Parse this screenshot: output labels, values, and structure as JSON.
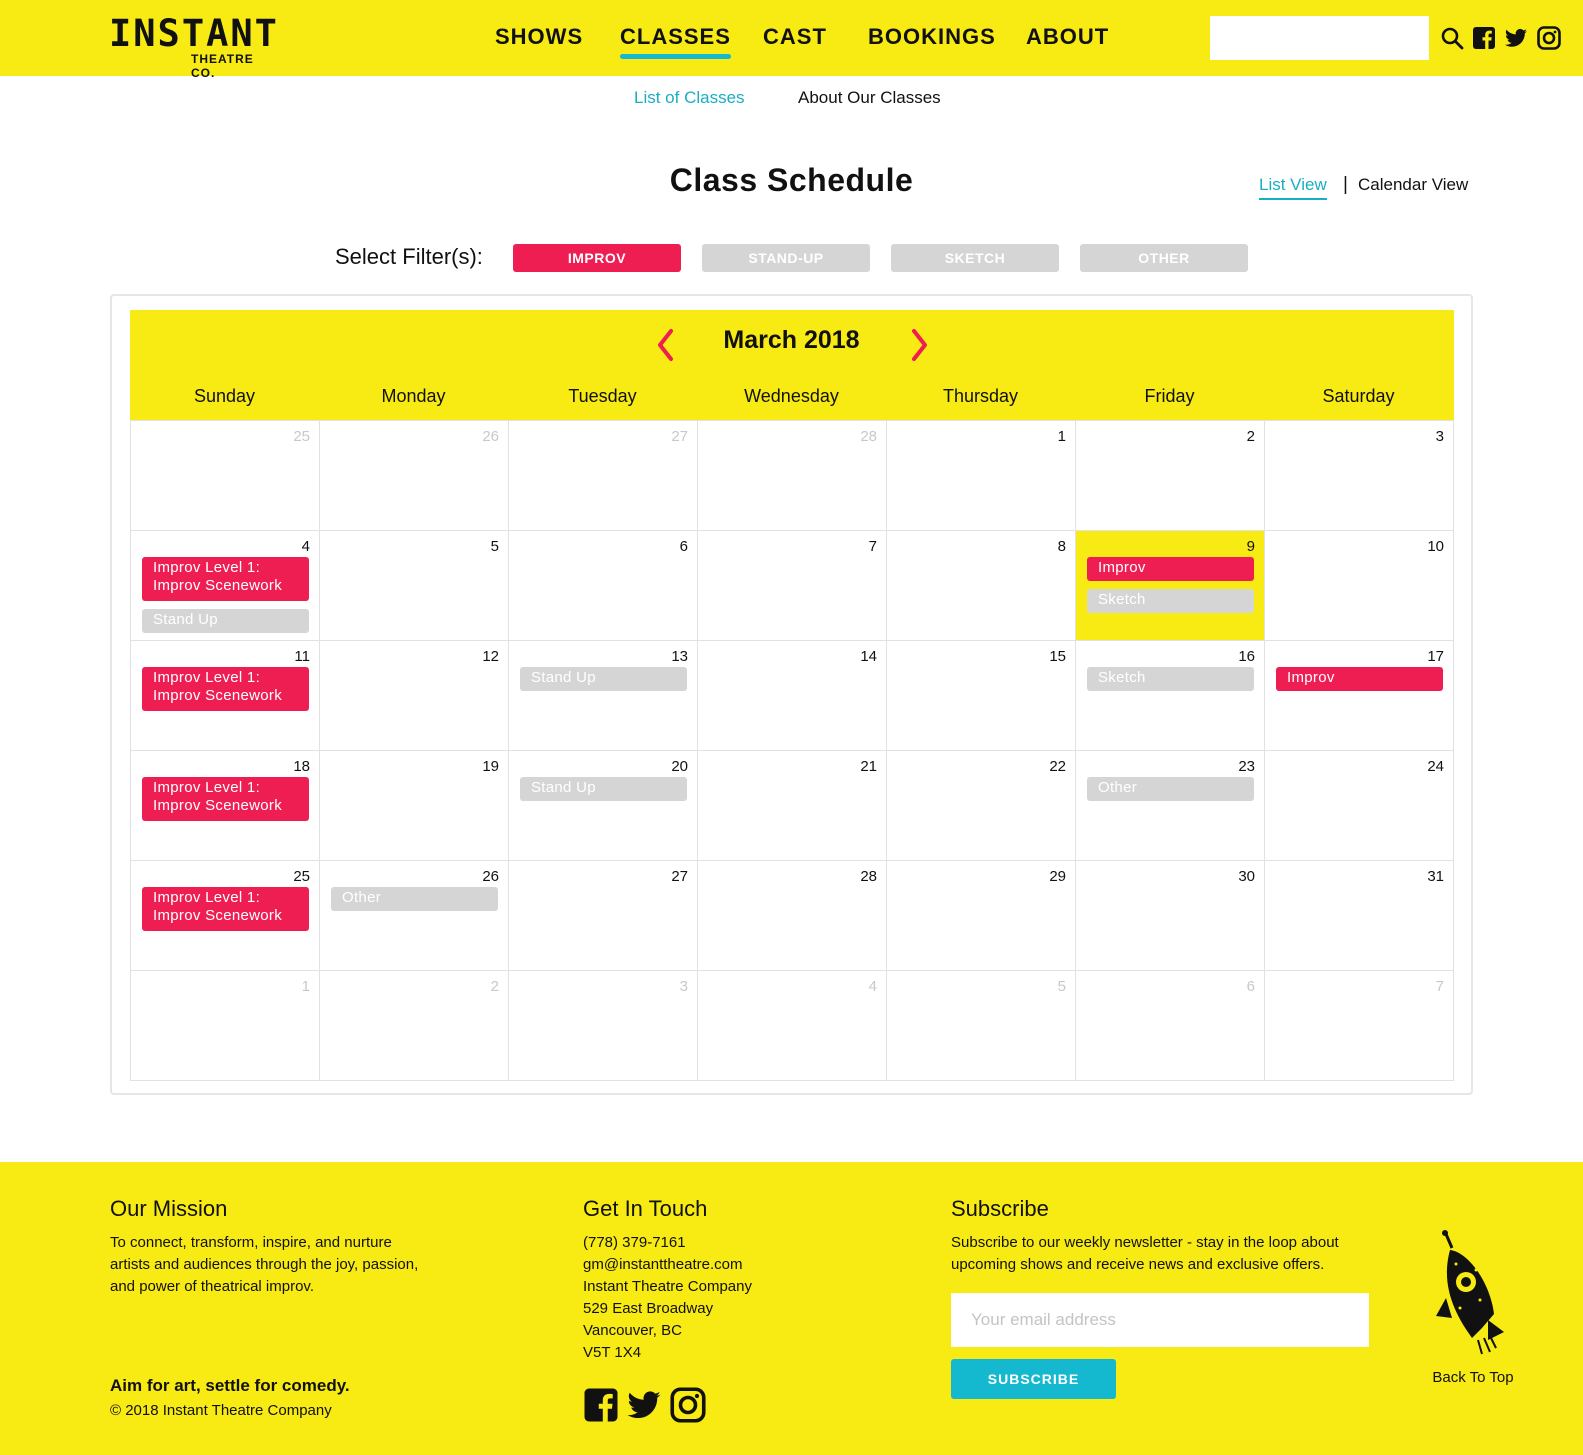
{
  "brand": {
    "logo_main": "INSTANT",
    "logo_sub": "THEATRE CO."
  },
  "nav": [
    {
      "label": "SHOWS",
      "active": false
    },
    {
      "label": "CLASSES",
      "active": true
    },
    {
      "label": "CAST",
      "active": false
    },
    {
      "label": "BOOKINGS",
      "active": false
    },
    {
      "label": "ABOUT",
      "active": false
    }
  ],
  "header_icons": [
    "search-icon",
    "facebook-icon",
    "twitter-icon",
    "instagram-icon"
  ],
  "subnav": [
    {
      "label": "List of Classes",
      "active": true
    },
    {
      "label": "About Our Classes",
      "active": false
    }
  ],
  "page_title": "Class Schedule",
  "views": {
    "list": "List View",
    "separator": "|",
    "calendar": "Calendar View",
    "active": "list"
  },
  "filters": {
    "label": "Select Filter(s):",
    "items": [
      {
        "label": "IMPROV",
        "on": true
      },
      {
        "label": "STAND-UP",
        "on": false
      },
      {
        "label": "SKETCH",
        "on": false
      },
      {
        "label": "OTHER",
        "on": false
      }
    ]
  },
  "calendar": {
    "month": "March 2018",
    "weekdays": [
      "Sunday",
      "Monday",
      "Tuesday",
      "Wednesday",
      "Thursday",
      "Friday",
      "Saturday"
    ],
    "weeks": [
      [
        {
          "day": "25",
          "dim": true,
          "events": []
        },
        {
          "day": "26",
          "dim": true,
          "events": []
        },
        {
          "day": "27",
          "dim": true,
          "events": []
        },
        {
          "day": "28",
          "dim": true,
          "events": []
        },
        {
          "day": "1",
          "events": []
        },
        {
          "day": "2",
          "events": []
        },
        {
          "day": "3",
          "events": []
        }
      ],
      [
        {
          "day": "4",
          "events": [
            {
              "label": "Improv Level 1: Improv Scenework",
              "type": "improv"
            },
            {
              "label": "Stand Up",
              "type": "standup"
            }
          ]
        },
        {
          "day": "5",
          "events": []
        },
        {
          "day": "6",
          "events": []
        },
        {
          "day": "7",
          "events": []
        },
        {
          "day": "8",
          "events": []
        },
        {
          "day": "9",
          "highlight": true,
          "events": [
            {
              "label": "Improv",
              "type": "improv"
            },
            {
              "label": "Sketch",
              "type": "sketch"
            }
          ]
        },
        {
          "day": "10",
          "events": []
        }
      ],
      [
        {
          "day": "11",
          "events": [
            {
              "label": "Improv Level 1: Improv Scenework",
              "type": "improv"
            }
          ]
        },
        {
          "day": "12",
          "events": []
        },
        {
          "day": "13",
          "events": [
            {
              "label": "Stand Up",
              "type": "standup"
            }
          ]
        },
        {
          "day": "14",
          "events": []
        },
        {
          "day": "15",
          "events": []
        },
        {
          "day": "16",
          "events": [
            {
              "label": "Sketch",
              "type": "sketch"
            }
          ]
        },
        {
          "day": "17",
          "events": [
            {
              "label": "Improv",
              "type": "improv"
            }
          ]
        }
      ],
      [
        {
          "day": "18",
          "events": [
            {
              "label": "Improv Level 1: Improv Scenework",
              "type": "improv"
            }
          ]
        },
        {
          "day": "19",
          "events": []
        },
        {
          "day": "20",
          "events": [
            {
              "label": "Stand Up",
              "type": "standup"
            }
          ]
        },
        {
          "day": "21",
          "events": []
        },
        {
          "day": "22",
          "events": []
        },
        {
          "day": "23",
          "events": [
            {
              "label": "Other",
              "type": "other"
            }
          ]
        },
        {
          "day": "24",
          "events": []
        }
      ],
      [
        {
          "day": "25",
          "events": [
            {
              "label": "Improv Level 1: Improv Scenework",
              "type": "improv"
            }
          ]
        },
        {
          "day": "26",
          "events": [
            {
              "label": "Other",
              "type": "other"
            }
          ]
        },
        {
          "day": "27",
          "events": []
        },
        {
          "day": "28",
          "events": []
        },
        {
          "day": "29",
          "events": []
        },
        {
          "day": "30",
          "events": []
        },
        {
          "day": "31",
          "events": []
        }
      ],
      [
        {
          "day": "1",
          "dim": true,
          "events": []
        },
        {
          "day": "2",
          "dim": true,
          "events": []
        },
        {
          "day": "3",
          "dim": true,
          "events": []
        },
        {
          "day": "4",
          "dim": true,
          "events": []
        },
        {
          "day": "5",
          "dim": true,
          "events": []
        },
        {
          "day": "6",
          "dim": true,
          "events": []
        },
        {
          "day": "7",
          "dim": true,
          "events": []
        }
      ]
    ]
  },
  "footer": {
    "mission": {
      "heading": "Our Mission",
      "lines": [
        "To connect, transform, inspire, and nurture",
        "artists and audiences through the joy, passion,",
        "and power of theatrical improv."
      ]
    },
    "tagline": "Aim for art, settle for comedy.",
    "copyright": "© 2018 Instant Theatre Company",
    "contact": {
      "heading": "Get In Touch",
      "lines": [
        "(778) 379-7161",
        "gm@instanttheatre.com",
        "Instant Theatre Company",
        "529 East Broadway",
        "Vancouver, BC",
        "V5T 1X4"
      ]
    },
    "subscribe": {
      "heading": "Subscribe",
      "lines": [
        "Subscribe to our weekly newsletter - stay in the loop about",
        "upcoming shows and receive news and exclusive offers."
      ],
      "placeholder": "Your email address",
      "button": "SUBSCRIBE"
    },
    "back_to_top": "Back To Top",
    "social_icons": [
      "facebook-icon",
      "twitter-icon",
      "instagram-icon"
    ]
  },
  "colors": {
    "yellow": "#f8ea13",
    "pink": "#ee1d52",
    "teal": "#14b8cf",
    "grey": "#d5d5d5"
  }
}
